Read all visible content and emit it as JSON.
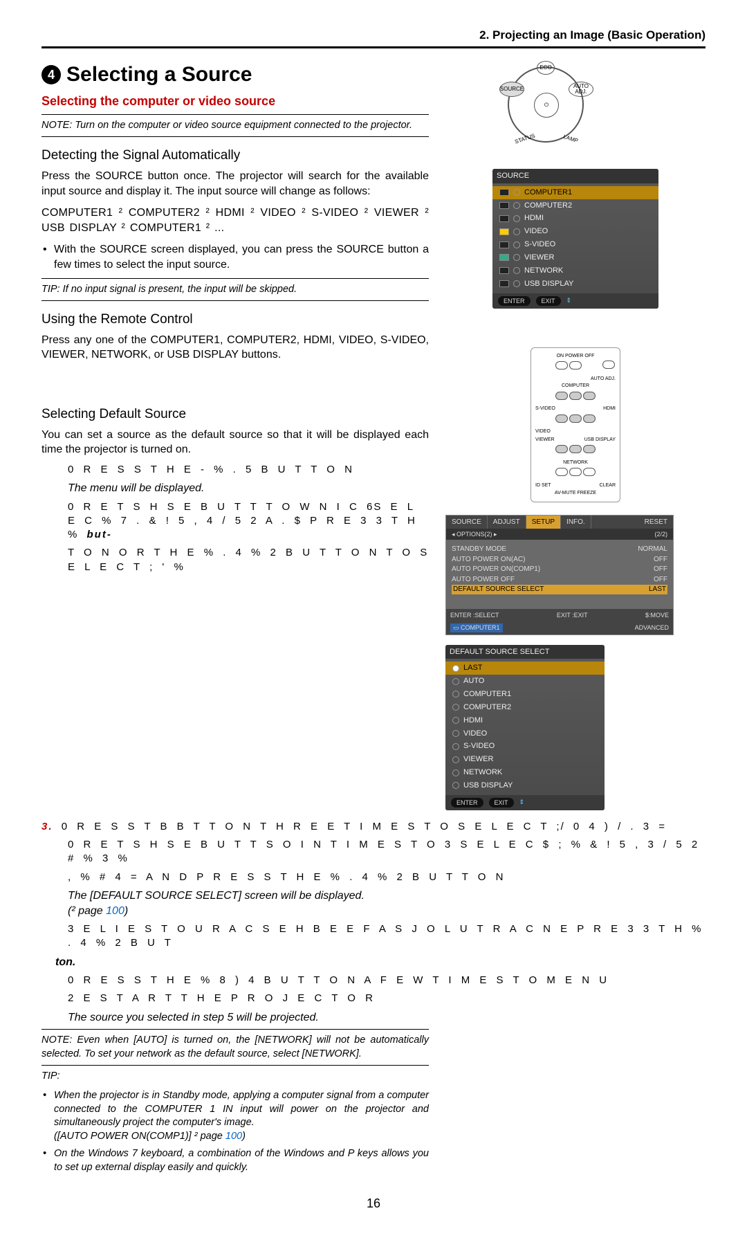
{
  "header": {
    "chapter": "2. Projecting an Image (Basic Operation)"
  },
  "title": {
    "num": "4",
    "text": "Selecting a Source"
  },
  "sub_red": "Selecting the computer or video source",
  "note1": "NOTE: Turn on the computer or video source equipment connected to the projector.",
  "h_detect": "Detecting the Signal Automatically",
  "p_detect": "Press the SOURCE button once. The projector will search for the available input source and display it. The input source will change as follows:",
  "seq": "COMPUTER1  ²   COMPUTER2  ²   HDMI  ²   VIDEO  ²   S-VIDEO  ²  VIEWER  ²   USB DISPLAY  ²   COMPUTER1  ²   ...",
  "bullet_source": "With the SOURCE screen displayed, you can press the SOURCE button a few times to select the input source.",
  "tip1": "TIP: If no input signal is present, the input will be skipped.",
  "h_remote": "Using the Remote Control",
  "p_remote": "Press any one of the COMPUTER1, COMPUTER2, HDMI, VIDEO, S-VIDEO, VIEWER, NETWORK, or USB DISPLAY buttons.",
  "h_default": "Selecting Default Source",
  "p_default": "You can set a source as the default source so that it will be displayed each time the projector is turned on.",
  "s1_a": "0 R E S S   T H E   - % . 5   B U T T O N",
  "s1_b": "The menu will be displayed.",
  "s2_a": "0 R E T S H S E  B U T T T O W N I C 6S  E L E C % 7 . &  ! 5  , 4  /  5 2  A . $  P R E 3 3  T H %",
  "s2_a_tail": "but-",
  "s2_b": "T O N   O R   T H E   % . 4 % 2   B U T T O N   T O   S E L E C T   ; ' %",
  "s3_num": "3.",
  "s3_a": "0 R E S S   T B B T T O N   T H R E E   T I M E S   T O   S E L E C T   ;/ 0 4 ) / . 3      =",
  "s4_a": "0 R E T S H S E  B U T T S O I N   T I M E S T O 3  S E L E C $ ;  % &  ! 5  , 3  /  5 2  # % 3  %",
  "s4_b": ", % # 4 =   A N D   P R E S S   T H E   % . 4 % 2   B U T T O N",
  "s4_c": "The [DEFAULT SOURCE SELECT] screen will be displayed.",
  "s4_d_a": "(²   page ",
  "s4_d_link": "100",
  "s4_d_b": ")",
  "s5_a": "3 E L  I E S T  O  U R A C S E  H B E  E F A S J O L  U T R A C N E  P R E 3 3  T H %   . 4 % 2  B U  T",
  "s5_tail": "ton.",
  "s6_a": "0 R E S S   T H E   % 8 ) 4   B U T T O N   A   F E W   T I M E S   T O                     M E N U",
  "s7_a": "2 E S T A R T   T H E   P R O J E C T O R",
  "s_proj": "The source you selected in step 5 will be projected.",
  "note2": "NOTE: Even when [AUTO] is turned on, the [NETWORK] will not be automatically selected. To set your network as the default source, select [NETWORK].",
  "tip_hdr": "TIP:",
  "tip2a": "When the projector is in Standby mode, applying a computer signal from a computer connected to the COMPUTER 1 IN input will power on the projector and simultaneously project the computer's image.",
  "tip2a_2a": "([AUTO POWER ON(COMP1)] ²   page ",
  "tip2a_link": "100",
  "tip2a_2b": ")",
  "tip2b": "On the Windows 7 keyboard, a combination of the Windows and P keys allows you to set up external display easily and quickly.",
  "page_num": "16",
  "fig_top": {
    "eco": "ECO",
    "source": "SOURCE",
    "auto": "AUTO\nADJ.",
    "status": "STATUS",
    "lamp": "LAMP"
  },
  "source_menu": {
    "title": "SOURCE",
    "items": [
      "COMPUTER1",
      "COMPUTER2",
      "HDMI",
      "VIDEO",
      "S-VIDEO",
      "VIEWER",
      "NETWORK",
      "USB DISPLAY"
    ],
    "enter": "ENTER",
    "exit": "EXIT"
  },
  "remote": {
    "poweroff": "ON POWER OFF",
    "autoadj": "AUTO ADJ.",
    "computer": "COMPUTER",
    "svideo": "S-VIDEO",
    "hdmi": "HDMI",
    "video": "VIDEO",
    "viewer": "VIEWER",
    "network": "NETWORK",
    "usb": "USB DISPLAY",
    "idset": "ID SET",
    "clear": "CLEAR",
    "avmute": "AV-MUTE  FREEZE"
  },
  "osd": {
    "tabs": [
      "SOURCE",
      "ADJUST",
      "SETUP",
      "INFO.",
      "RESET"
    ],
    "sub_left": "◂ OPTIONS(2) ▸",
    "sub_right": "(2/2)",
    "rows": [
      {
        "k": "STANDBY MODE",
        "v": "NORMAL"
      },
      {
        "k": "AUTO POWER ON(AC)",
        "v": "OFF"
      },
      {
        "k": "AUTO POWER ON(COMP1)",
        "v": "OFF"
      },
      {
        "k": "AUTO POWER OFF",
        "v": "OFF"
      },
      {
        "k": "DEFAULT SOURCE SELECT",
        "v": "LAST"
      }
    ],
    "enter": "ENTER :SELECT",
    "exit": "EXIT :EXIT",
    "move": "$:MOVE",
    "comp": "COMPUTER1",
    "adv": "ADVANCED"
  },
  "dss": {
    "title": "DEFAULT SOURCE SELECT",
    "items": [
      "LAST",
      "AUTO",
      "COMPUTER1",
      "COMPUTER2",
      "HDMI",
      "VIDEO",
      "S-VIDEO",
      "VIEWER",
      "NETWORK",
      "USB DISPLAY"
    ],
    "enter": "ENTER",
    "exit": "EXIT"
  }
}
